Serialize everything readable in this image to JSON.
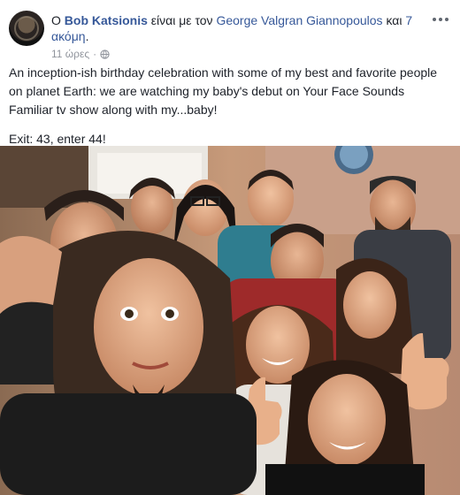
{
  "post": {
    "author": "Bob Katsionis",
    "prefix": "Ο",
    "with_text": "είναι με τον",
    "tagged": "George Valgran Giannopoulos",
    "and_text": "και",
    "others": "7 ακόμη",
    "period": ".",
    "time": "11 ώρες",
    "separator": "·",
    "paragraph1": "An inception-ish birthday celebration with some of my best and favorite people on planet Earth: we are watching my baby's debut on Your Face Sounds Familiar tv show along with my...baby!",
    "paragraph2": "Exit: 43, enter 44!"
  },
  "icons": {
    "avatar": "profile-photo",
    "privacy": "globe-icon",
    "more": "more-options-icon"
  },
  "colors": {
    "link": "#365899",
    "meta": "#90949c",
    "text": "#1d2129"
  }
}
